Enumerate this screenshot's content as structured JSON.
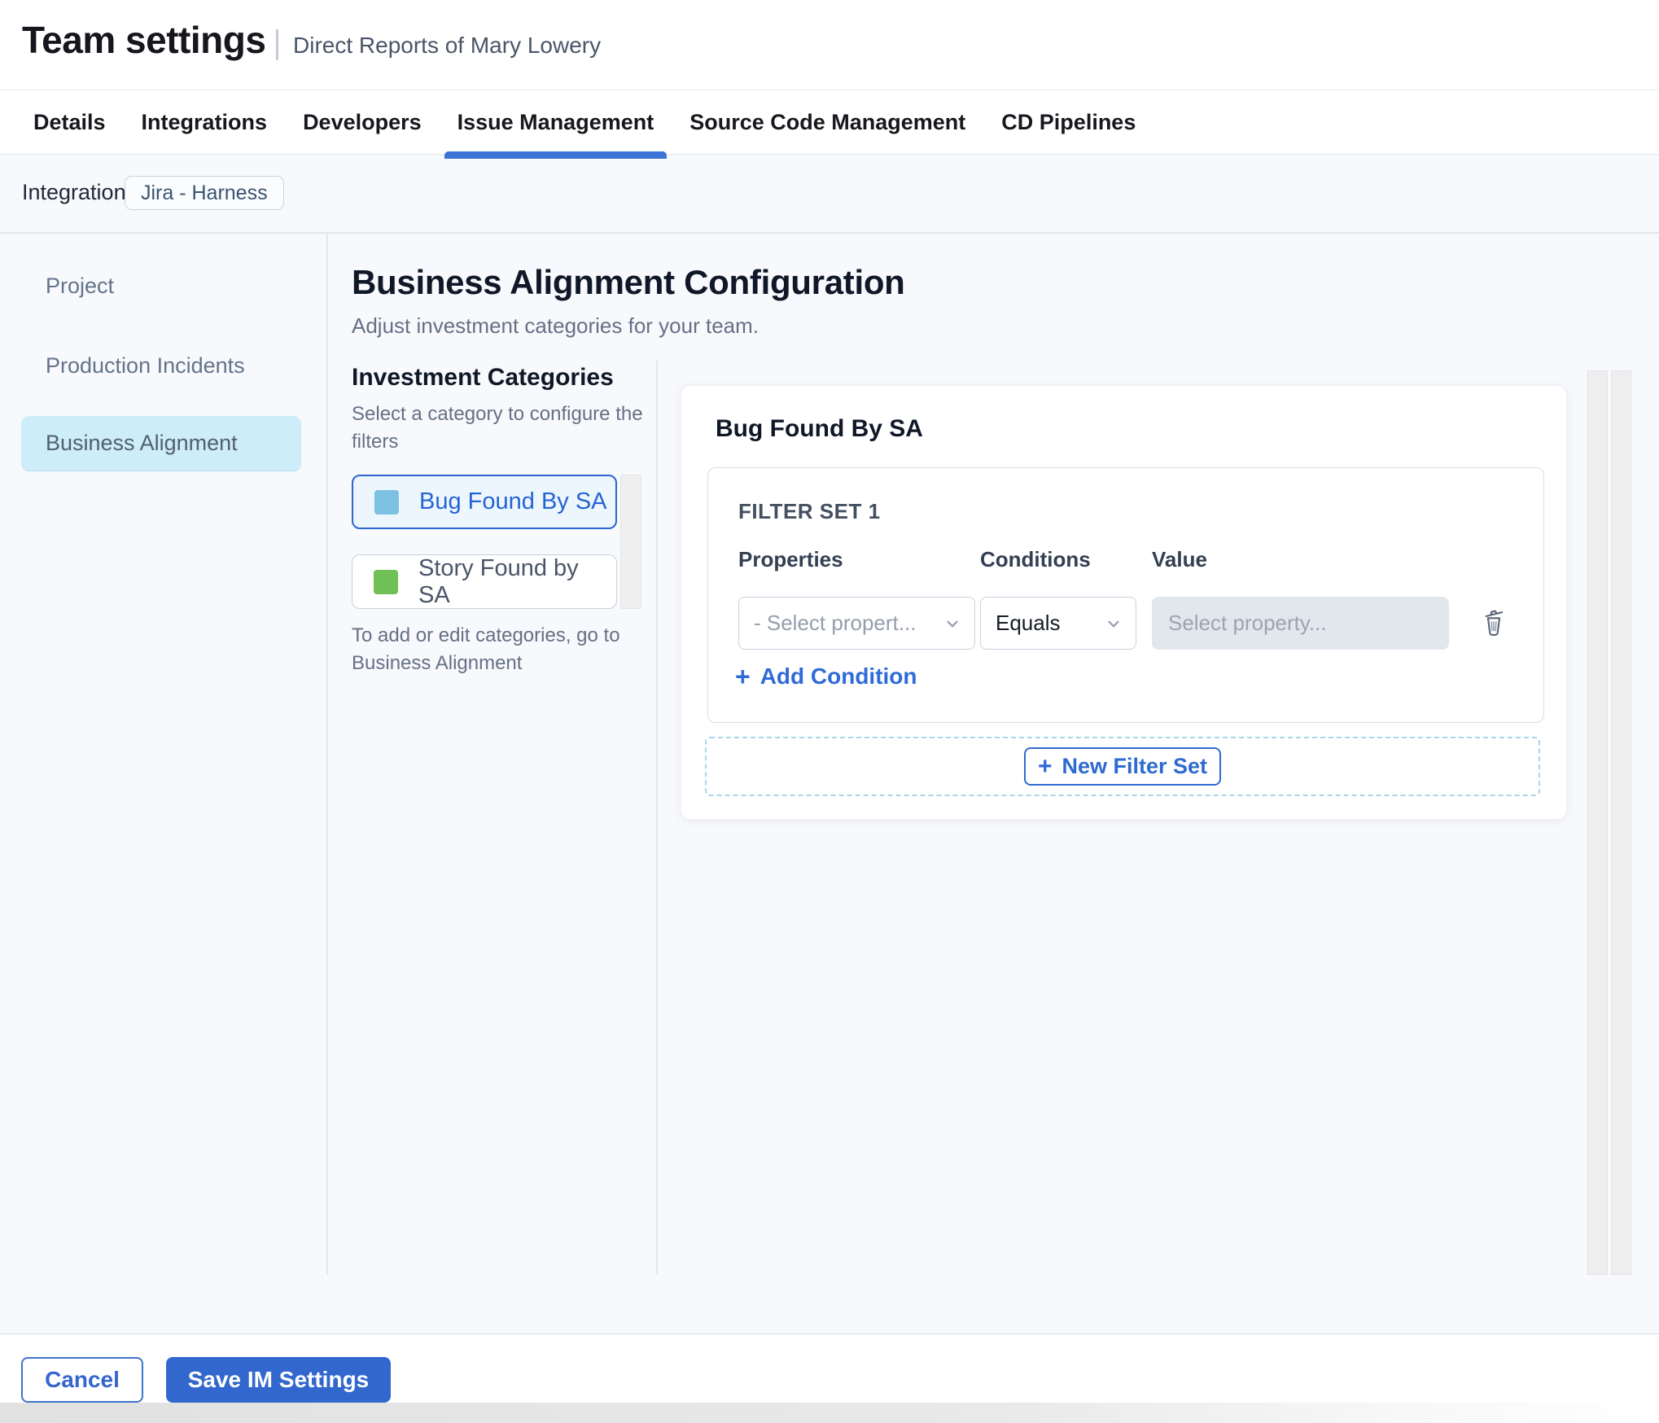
{
  "header": {
    "title": "Team settings",
    "subtitle": "Direct Reports of Mary Lowery"
  },
  "tabs": {
    "items": [
      {
        "label": "Details",
        "active": false
      },
      {
        "label": "Integrations",
        "active": false
      },
      {
        "label": "Developers",
        "active": false
      },
      {
        "label": "Issue Management",
        "active": true
      },
      {
        "label": "Source Code Management",
        "active": false
      },
      {
        "label": "CD Pipelines",
        "active": false
      }
    ]
  },
  "integration": {
    "label": "Integration:",
    "badge": "Jira - Harness"
  },
  "sidebar": {
    "items": [
      {
        "label": "Project",
        "selected": false
      },
      {
        "label": "Production Incidents",
        "selected": false
      },
      {
        "label": "Business Alignment",
        "selected": true
      }
    ]
  },
  "main": {
    "title": "Business Alignment Configuration",
    "subtitle": "Adjust investment categories for your team.",
    "categories": {
      "title": "Investment Categories",
      "description": "Select a category to configure the filters",
      "items": [
        {
          "label": "Bug Found By SA",
          "swatch_color": "#7cc0e2",
          "selected": true
        },
        {
          "label": "Story Found by SA",
          "swatch_color": "#70c057",
          "selected": false
        }
      ],
      "note": "To add or edit categories, go to Business Alignment"
    },
    "filter_panel": {
      "title": "Bug Found By SA",
      "filter_set_title": "FILTER SET 1",
      "columns": [
        "Properties",
        "Conditions",
        "Value"
      ],
      "property_placeholder": "- Select propert...",
      "condition_value": "Equals",
      "value_placeholder": "Select property...",
      "add_condition_label": "Add Condition",
      "new_filter_set_label": "New Filter Set",
      "plus_glyph": "+"
    }
  },
  "footer": {
    "cancel_label": "Cancel",
    "save_label": "Save IM Settings"
  },
  "colors": {
    "accent_blue": "#3268cd",
    "tab_underline": "#3b74d6",
    "link_blue": "#2f6bd8",
    "selected_category_bg": "#edf6fd",
    "selected_category_border": "#2b66d0",
    "selected_category_text": "#2464d4",
    "sidebar_selected_bg": "#cdedf8",
    "content_bg": "#f7f9fc",
    "value_input_bg": "#e2e7ed",
    "swatch_blue": "#7cc0e2",
    "swatch_green": "#70c057"
  }
}
